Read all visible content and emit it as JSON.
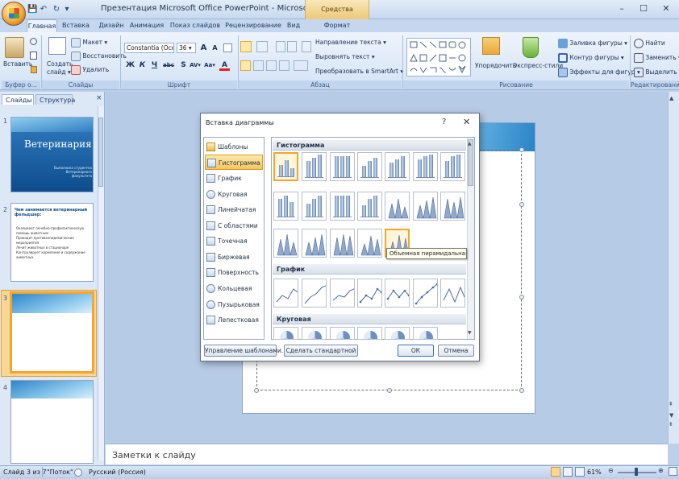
{
  "window": {
    "title": "Презентация Microsoft Office PowerPoint - Microsoft PowerPoint",
    "context_tab": "Средства рисования",
    "minimize": "–",
    "maximize": "☐",
    "close": "✕"
  },
  "qat": {
    "save": "💾",
    "undo": "↶",
    "redo": "↻",
    "more": "▾"
  },
  "tabs": [
    "Главная",
    "Вставка",
    "Дизайн",
    "Анимация",
    "Показ слайдов",
    "Рецензирование",
    "Вид",
    "Формат"
  ],
  "active_tab": "Главная",
  "ribbon": {
    "clipboard": {
      "paste": "Вставить",
      "label": "Буфер о..."
    },
    "slides": {
      "new_slide": "Создать",
      "new_slide2": "слайд ▾",
      "layout": "Макет ▾",
      "reset": "Восстановить",
      "delete": "Удалить",
      "label": "Слайды"
    },
    "font": {
      "name": "Constantia (Осн ▾",
      "size": "36 ▾",
      "grow": "A",
      "shrink": "A",
      "bold": "Ж",
      "italic": "К",
      "underline": "Ч",
      "strike": "abc",
      "shadow": "S",
      "spacing": "AV▾",
      "case": "Аа▾",
      "color": "A",
      "label": "Шрифт"
    },
    "paragraph": {
      "direction": "Направление текста ▾",
      "align_text": "Выровнять текст ▾",
      "smartart": "Преобразовать в SmartArt ▾",
      "label": "Абзац"
    },
    "drawing": {
      "arrange": "Упорядочить",
      "quick_styles": "Экспресс-стили",
      "fill": "Заливка фигуры ▾",
      "outline": "Контур фигуры ▾",
      "effects": "Эффекты для фигур ▾",
      "label": "Рисование"
    },
    "editing": {
      "find": "Найти",
      "replace": "Заменить ▾",
      "select": "Выделить ▾",
      "label": "Редактирование"
    }
  },
  "left_pane": {
    "tabs": [
      "Слайды",
      "Структура"
    ],
    "close": "×",
    "slides": [
      {
        "num": "1",
        "title": "Ветеринария",
        "subtitle": "Выполнила студентка\nВетеринарного факультета"
      },
      {
        "num": "2",
        "title": "Чем занимается ветеринарный фельдшер:",
        "bullets": [
          "Оказывает лечебно-профилактическую помощь животным",
          "Проводит противоэпидемические мероприятия",
          "Лечит животных в стационаре",
          "Контролирует кормление и содержание животных"
        ]
      },
      {
        "num": "3"
      },
      {
        "num": "4"
      }
    ]
  },
  "notes_placeholder": "Заметки к слайду",
  "status": {
    "slide": "Слайд 3 из 7",
    "theme": "\"Поток\"",
    "language": "Русский (Россия)",
    "zoom": "61%"
  },
  "dialog": {
    "title": "Вставка диаграммы",
    "help": "?",
    "close": "✕",
    "categories": [
      "Шаблоны",
      "Гистограмма",
      "График",
      "Круговая",
      "Линейчатая",
      "С областями",
      "Точечная",
      "Биржевая",
      "Поверхность",
      "Кольцевая",
      "Пузырьковая",
      "Лепестковая"
    ],
    "selected_category": "Гистограмма",
    "sections": {
      "histogram": "Гистограмма",
      "line": "График",
      "pie": "Круговая"
    },
    "tooltip": "Объемная пирамидальная",
    "buttons": {
      "manage": "Управление шаблонами...",
      "default": "Сделать стандартной",
      "ok": "ОК",
      "cancel": "Отмена"
    }
  }
}
